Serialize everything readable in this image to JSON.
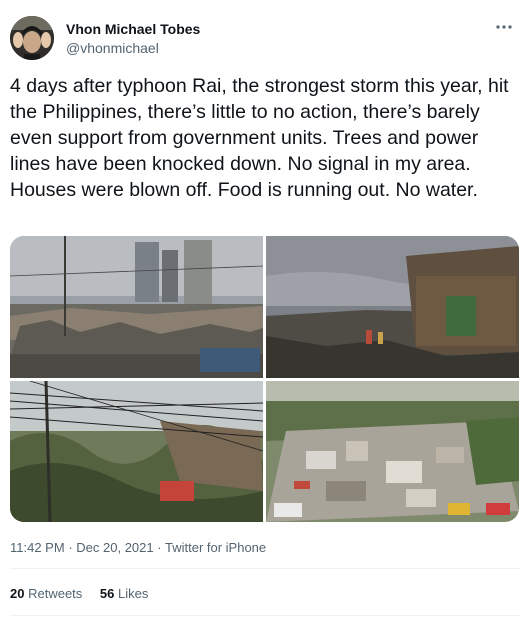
{
  "user": {
    "display_name": "Vhon Michael Tobes",
    "handle": "@vhonmichael",
    "avatar_icon": "avatar-photo"
  },
  "menu": {
    "more_icon": "more-horizontal-icon"
  },
  "tweet": {
    "text": "4 days after typhoon Rai, the strongest storm this year, hit the Philippines, there’s little to no action, there’s barely even support from government units. Trees and power lines have been knocked down. No signal in my area. Houses were blown off. Food is running out. No water."
  },
  "media": {
    "photos": [
      {
        "name": "photo-damaged-site-with-towers"
      },
      {
        "name": "photo-wrecked-street-stalls"
      },
      {
        "name": "photo-fallen-power-lines-and-trees"
      },
      {
        "name": "photo-aerial-destroyed-houses"
      }
    ]
  },
  "meta": {
    "time": "11:42 PM",
    "separator": "·",
    "date": "Dec 20, 2021",
    "source": "Twitter for iPhone"
  },
  "stats": {
    "retweets_count": "20",
    "retweets_label": "Retweets",
    "likes_count": "56",
    "likes_label": "Likes"
  },
  "colors": {
    "text": "#0f1419",
    "secondary": "#536471",
    "divider": "#eff3f4"
  }
}
